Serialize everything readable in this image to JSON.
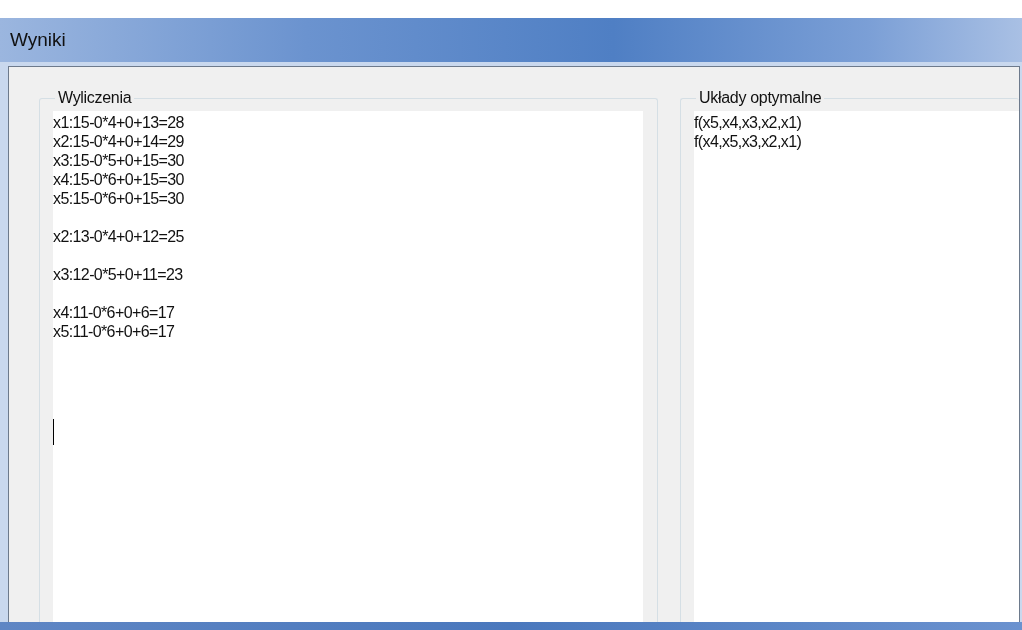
{
  "window": {
    "title": "Wyniki"
  },
  "calculations": {
    "label": "Wyliczenia",
    "groups": [
      [
        "x1:15-0*4+0+13=28",
        "x2:15-0*4+0+14=29",
        "x3:15-0*5+0+15=30",
        "x4:15-0*6+0+15=30",
        "x5:15-0*6+0+15=30"
      ],
      [
        "x2:13-0*4+0+12=25"
      ],
      [
        "x3:12-0*5+0+11=23"
      ],
      [
        "x4:11-0*6+0+6=17",
        "x5:11-0*6+0+6=17"
      ]
    ]
  },
  "optimal": {
    "label": "Układy optymalne",
    "lines": [
      "f(x5,x4,x3,x2,x1)",
      "f(x4,x5,x3,x2,x1)"
    ]
  }
}
